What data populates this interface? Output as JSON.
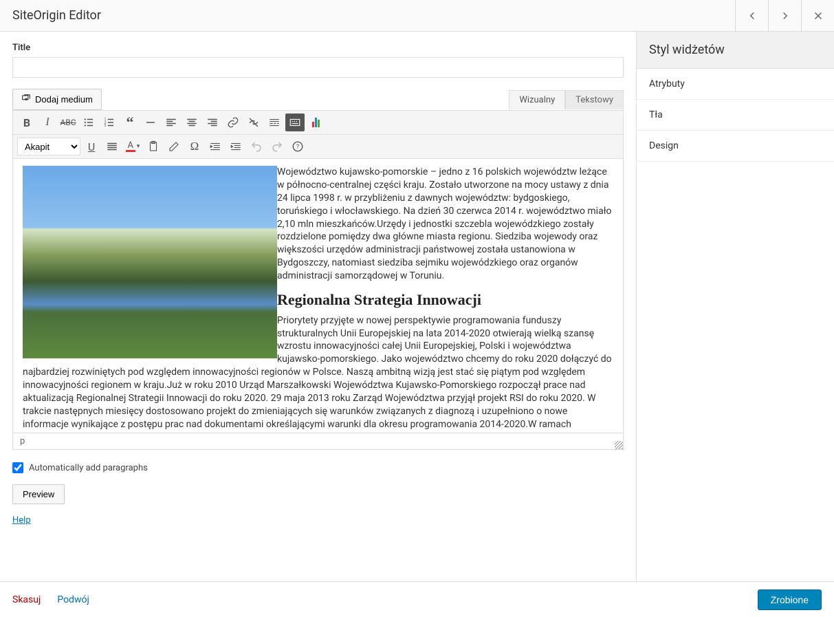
{
  "header": {
    "title": "SiteOrigin Editor"
  },
  "fields": {
    "title_label": "Title",
    "title_value": ""
  },
  "media": {
    "add_label": "Dodaj medium"
  },
  "tabs": {
    "visual": "Wizualny",
    "text": "Tekstowy"
  },
  "format_select": "Akapit",
  "content": {
    "para1": "Województwo kujawsko-pomorskie – jedno z 16 polskich województw leżące w północno-centralnej części kraju. Zostało utworzone na mocy ustawy z dnia 24 lipca 1998 r. w przybliżeniu z dawnych województw: bydgoskiego, toruńskiego i włocławskiego. Na dzień 30 czerwca 2014 r. województwo miało 2,10 mln mieszkańców.Urzędy i jednostki szczebla wojewódzkiego zostały rozdzielone pomiędzy dwa główne miasta regionu. Siedziba wojewody oraz większości urzędów administracji państwowej została ustanowiona w Bydgoszczy, natomiast siedziba sejmiku wojewódzkiego oraz organów administracji samorządowej w Toruniu.",
    "heading": "Regionalna Strategia Innowacji",
    "para2": "Priorytety przyjęte w nowej perspektywie programowania funduszy strukturalnych Unii Europejskiej na lata 2014-2020 otwierają wielką szansę wzrostu innowacyjności całej Unii Europejskiej, Polski i województwa kujawsko-pomorskiego. Jako województwo chcemy do roku 2020 dołączyć do najbardziej rozwiniętych pod względem innowacyjności regionów w Polsce. Naszą ambitną wizją jest stać się piątym pod względem innowacyjności regionem w kraju.Już w roku 2010 Urząd Marszałkowski Województwa Kujawsko-Pomorskiego rozpoczął prace nad aktualizacją Regionalnej Strategii Innowacji do roku 2020. 29 maja 2013 roku Zarząd Województwa przyjął projekt RSI do roku 2020. W trakcie następnych miesięcy dostosowano projekt do zmieniających się warunków związanych z diagnozą i uzupełniono o nowe informacje wynikające z postępu prac nad dokumentami określającymi warunki dla okresu programowania 2014-2020.W ramach przeprowadzonej aktualizacji dokonano ewaluacji efektów wdrażania dotychczasowej strategii. Zaktualizowano także diagnozę sytuacji województwa kujawsko-pomorskiego w obszarze innowacyjności. Powyższe prace pozwoliły na udzielenie odpowiedzi na podstawowe pytania:"
  },
  "status_path": "p",
  "auto_paragraphs": {
    "label": "Automatically add paragraphs",
    "checked": true
  },
  "preview_button": "Preview",
  "help_link": "Help",
  "sidebar": {
    "title": "Styl widżetów",
    "items": [
      "Atrybuty",
      "Tła",
      "Design"
    ]
  },
  "footer": {
    "cancel": "Skasuj",
    "duplicate": "Podwój",
    "done": "Zrobione"
  }
}
